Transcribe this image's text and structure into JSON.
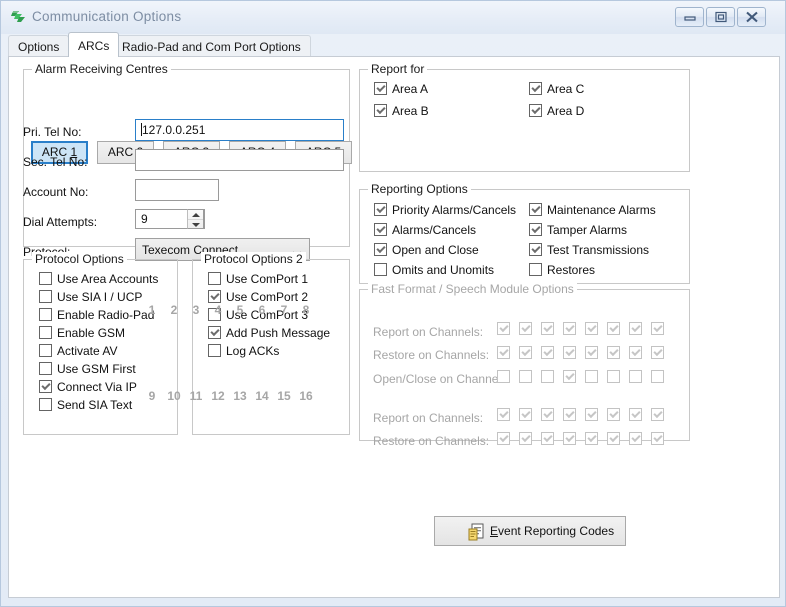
{
  "window": {
    "title": "Communication Options",
    "icon": "app-stripes-icon",
    "controls": {
      "minimize": "minimize-icon",
      "maximize": "maximize-icon",
      "close": "close-icon"
    }
  },
  "tabs": [
    {
      "label": "Options",
      "active": false
    },
    {
      "label": "ARCs",
      "active": true
    },
    {
      "label": "Radio-Pad and Com Port Options",
      "active": false
    }
  ],
  "arc_group": {
    "title": "Alarm Receiving Centres",
    "buttons": [
      {
        "prefix": "ARC ",
        "key": "1",
        "selected": true
      },
      {
        "prefix": "ARC ",
        "key": "2",
        "selected": false
      },
      {
        "prefix": "ARC ",
        "key": "3",
        "selected": false
      },
      {
        "prefix": "ARC ",
        "key": "4",
        "selected": false
      },
      {
        "prefix": "ARC ",
        "key": "5",
        "selected": false
      }
    ],
    "fields": {
      "pri_tel_label": "Pri. Tel No:",
      "pri_tel_value": "127.0.0.251",
      "sec_tel_label": "Sec. Tel No:",
      "sec_tel_value": "",
      "account_label": "Account No:",
      "account_value": "",
      "dial_attempts_label": "Dial Attempts:",
      "dial_attempts_value": "9",
      "protocol_label": "Protocol:",
      "protocol_value": "Texecom Connect"
    }
  },
  "protocol_options": {
    "title": "Protocol Options",
    "items": [
      {
        "label": "Use Area Accounts",
        "checked": false
      },
      {
        "label": "Use SIA I / UCP",
        "checked": false
      },
      {
        "label": "Enable Radio-Pad",
        "checked": false
      },
      {
        "label": "Enable GSM",
        "checked": false
      },
      {
        "label": "Activate AV",
        "checked": false
      },
      {
        "label": "Use GSM First",
        "checked": false
      },
      {
        "label": "Connect Via IP",
        "checked": true
      },
      {
        "label": "Send SIA Text",
        "checked": false
      }
    ]
  },
  "protocol_options_2": {
    "title": "Protocol Options 2",
    "items": [
      {
        "label": "Use ComPort 1",
        "checked": false
      },
      {
        "label": "Use ComPort 2",
        "checked": true
      },
      {
        "label": "Use ComPort 3",
        "checked": false
      },
      {
        "label": "Add Push Message",
        "checked": true
      },
      {
        "label": "Log ACKs",
        "checked": false
      }
    ]
  },
  "report_for": {
    "title": "Report for",
    "items": [
      {
        "label": "Area A",
        "checked": true
      },
      {
        "label": "Area B",
        "checked": true
      },
      {
        "label": "Area C",
        "checked": true
      },
      {
        "label": "Area D",
        "checked": true
      }
    ]
  },
  "reporting_options": {
    "title": "Reporting Options",
    "items": [
      {
        "label": "Priority Alarms/Cancels",
        "checked": true
      },
      {
        "label": "Alarms/Cancels",
        "checked": true
      },
      {
        "label": "Open and Close",
        "checked": true
      },
      {
        "label": "Omits and Unomits",
        "checked": false
      },
      {
        "label": "Maintenance Alarms",
        "checked": true
      },
      {
        "label": "Tamper Alarms",
        "checked": true
      },
      {
        "label": "Test Transmissions",
        "checked": true
      },
      {
        "label": "Restores",
        "checked": false
      }
    ]
  },
  "fast_format": {
    "title": "Fast Format / Speech Module Options",
    "enabled": false,
    "channel_header_1": [
      "1",
      "2",
      "3",
      "4",
      "5",
      "6",
      "7",
      "8"
    ],
    "channel_header_2": [
      "9",
      "10",
      "11",
      "12",
      "13",
      "14",
      "15",
      "16"
    ],
    "rows": [
      {
        "label": "Report on Channels:",
        "checked": [
          true,
          true,
          true,
          true,
          true,
          true,
          true,
          true
        ]
      },
      {
        "label": "Restore on Channels:",
        "checked": [
          true,
          true,
          true,
          true,
          true,
          true,
          true,
          true
        ]
      },
      {
        "label": "Open/Close on Channels:",
        "checked": [
          false,
          false,
          false,
          true,
          false,
          false,
          false,
          false
        ]
      },
      {
        "label": "Report on Channels:",
        "checked": [
          true,
          true,
          true,
          true,
          true,
          true,
          true,
          true
        ]
      },
      {
        "label": "Restore on Channels:",
        "checked": [
          true,
          true,
          true,
          true,
          true,
          true,
          true,
          true
        ]
      }
    ]
  },
  "event_reporting_button": {
    "icon": "document-report-icon",
    "accel": "E",
    "label_rest": "vent Reporting Codes",
    "full_label": "Event Reporting Codes"
  },
  "colors": {
    "accent_blue": "#2a7fc9",
    "selected_fill": "#cde5f7",
    "title_text": "#7d8da3",
    "disabled_text": "#a6a6a6",
    "window_bg": "#dfe8f5"
  }
}
